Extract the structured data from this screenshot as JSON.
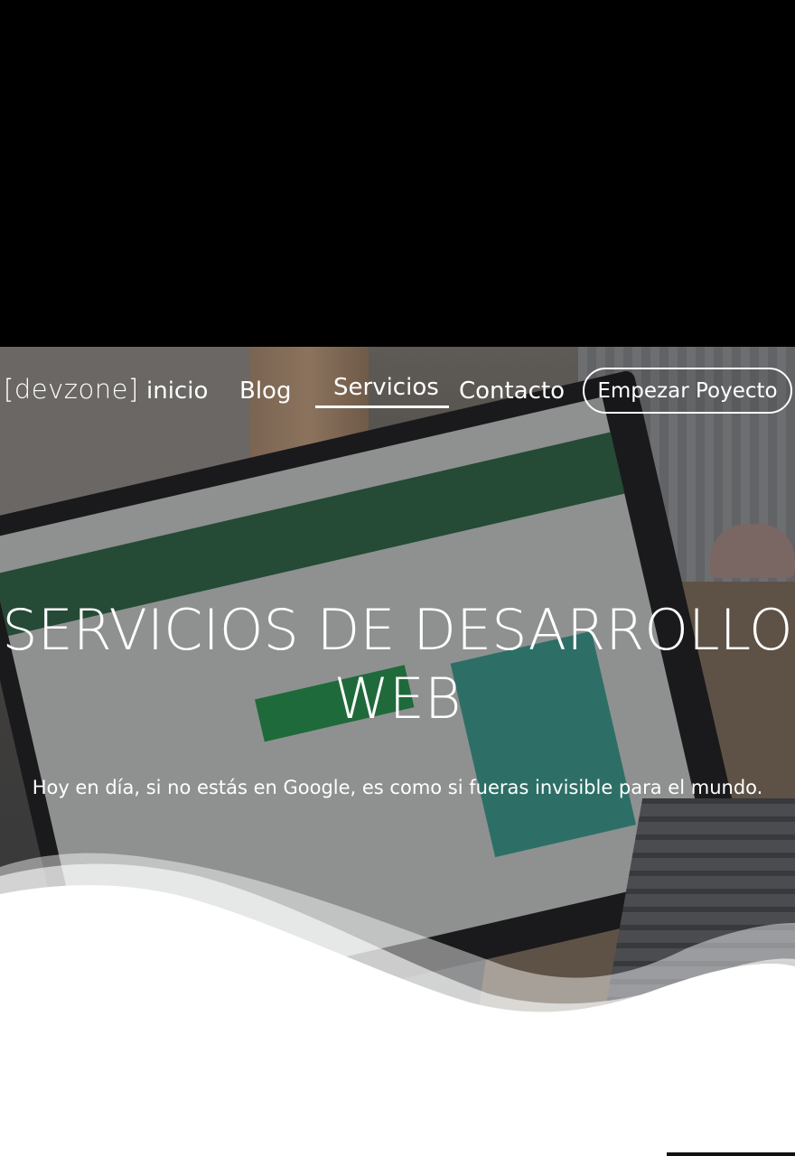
{
  "brand": {
    "logo_text": "[devzone]"
  },
  "nav": {
    "items": [
      {
        "label": "inicio"
      },
      {
        "label": "Blog"
      },
      {
        "label": "Servicios",
        "active": true
      },
      {
        "label": "Contacto"
      }
    ],
    "cta_label": "Empezar Poyecto"
  },
  "hero": {
    "title_line1": "SERVICIOS DE DESARROLLO",
    "title_line2": "WEB",
    "subtitle": "Hoy en día, si no estás en Google, es como si fueras invisible para el mundo."
  },
  "colors": {
    "text": "#ffffff",
    "top_band": "#000000",
    "page": "#ffffff"
  }
}
